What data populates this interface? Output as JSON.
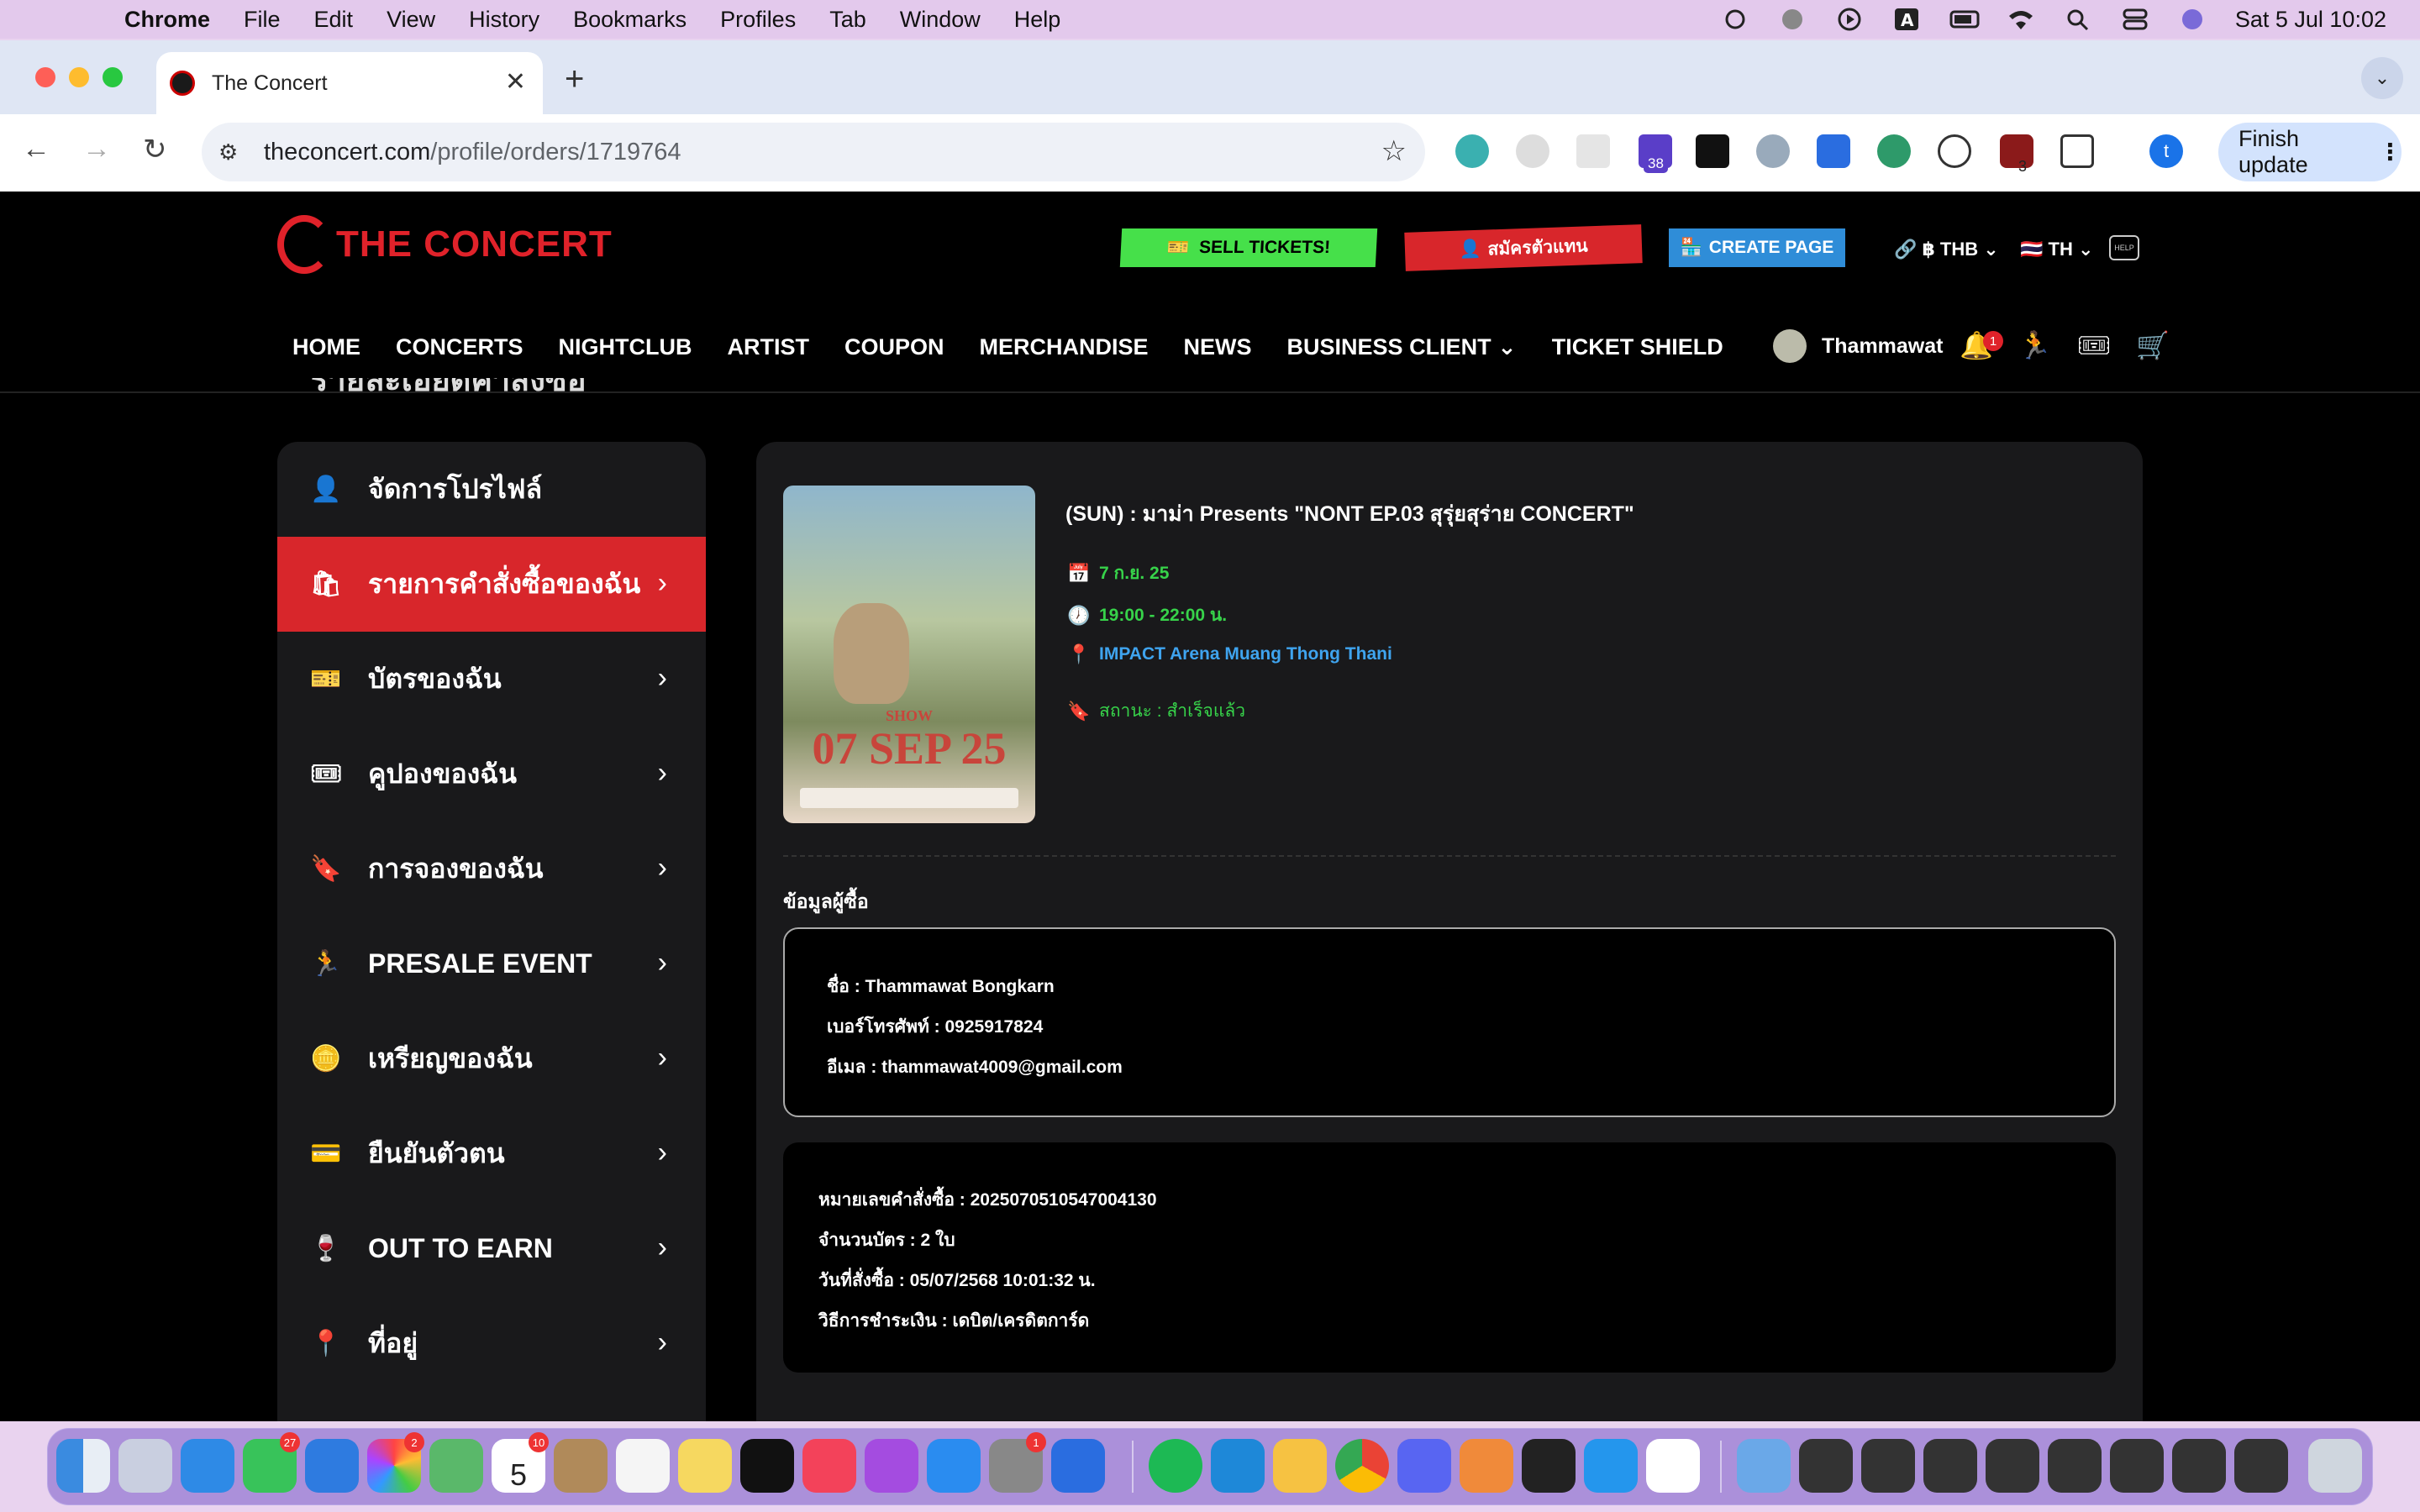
{
  "macos": {
    "app_name": "Chrome",
    "menu": [
      "File",
      "Edit",
      "View",
      "History",
      "Bookmarks",
      "Profiles",
      "Tab",
      "Window",
      "Help"
    ],
    "clock": "Sat 5 Jul  10:02",
    "status_icons": [
      "weather-icon",
      "globe-icon",
      "play-icon",
      "input-source-icon",
      "battery-icon",
      "wifi-icon",
      "search-icon",
      "control-center-icon",
      "siri-icon"
    ]
  },
  "browser": {
    "tab_title": "The Concert",
    "url_host": "theconcert.com",
    "url_path": "/profile/orders/1719764",
    "ext_badge_1": "38",
    "ext_badge_2": "3",
    "profile_initial": "t",
    "finish_update": "Finish update"
  },
  "site": {
    "brand": "THE CONCERT",
    "sell_tickets": "SELL TICKETS!",
    "register_agent": "สมัครตัวแทน",
    "create_page": "CREATE PAGE",
    "currency": "฿ THB",
    "language": "TH",
    "help_label": "HELP",
    "nav": [
      "HOME",
      "CONCERTS",
      "NIGHTCLUB",
      "ARTIST",
      "COUPON",
      "MERCHANDISE",
      "NEWS",
      "BUSINESS CLIENT",
      "TICKET SHIELD"
    ],
    "user_name": "Thammawat",
    "notif_count": "1",
    "breadcrumb_partial": "รายละเอียดคำสั่งซื้อ"
  },
  "sidebar": {
    "items": [
      {
        "label": "จัดการโปรไฟล์",
        "icon": "user-icon"
      },
      {
        "label": "รายการคำสั่งซื้อของฉัน",
        "icon": "bag-icon"
      },
      {
        "label": "บัตรของฉัน",
        "icon": "ticket-icon"
      },
      {
        "label": "คูปองของฉัน",
        "icon": "coupon-icon"
      },
      {
        "label": "การจองของฉัน",
        "icon": "bookmark-icon"
      },
      {
        "label": "PRESALE EVENT",
        "icon": "runner-icon"
      },
      {
        "label": "เหรียญของฉัน",
        "icon": "coins-icon"
      },
      {
        "label": "ยืนยันตัวตน",
        "icon": "id-card-icon"
      },
      {
        "label": "OUT TO EARN",
        "icon": "drink-icon"
      },
      {
        "label": "ที่อยู่",
        "icon": "pin-icon"
      }
    ]
  },
  "event": {
    "title": "(SUN) : มาม่า Presents \"NONT EP.03 สุรุ่ยสุร่าย CONCERT\"",
    "date": "7 ก.ย. 25",
    "time": "19:00 - 22:00 น.",
    "venue": "IMPACT Arena Muang Thong Thani",
    "status": "สถานะ : สำเร็จแล้ว",
    "poster_show": "SHOW",
    "poster_date": "07 SEP 25"
  },
  "buyer": {
    "heading": "ข้อมูลผู้ซื้อ",
    "name": "ชื่อ : Thammawat Bongkarn",
    "phone": "เบอร์โทรศัพท์ : 0925917824",
    "email": "อีเมล : thammawat4009@gmail.com"
  },
  "order": {
    "number": "หมายเลขคำสั่งซื้อ : 2025070510547004130",
    "tickets": "จำนวนบัตร : 2 ใบ",
    "ordered_at": "วันที่สั่งซื้อ : 05/07/2568 10:01:32 น.",
    "payment": "วิธีการชำระเงิน : เดบิต/เครดิตการ์ด"
  },
  "dock": {
    "badges": {
      "messages": "27",
      "photos": "2",
      "calendar": "10",
      "settings": "1"
    },
    "calendar_day": "5",
    "calendar_month": "JUL"
  }
}
